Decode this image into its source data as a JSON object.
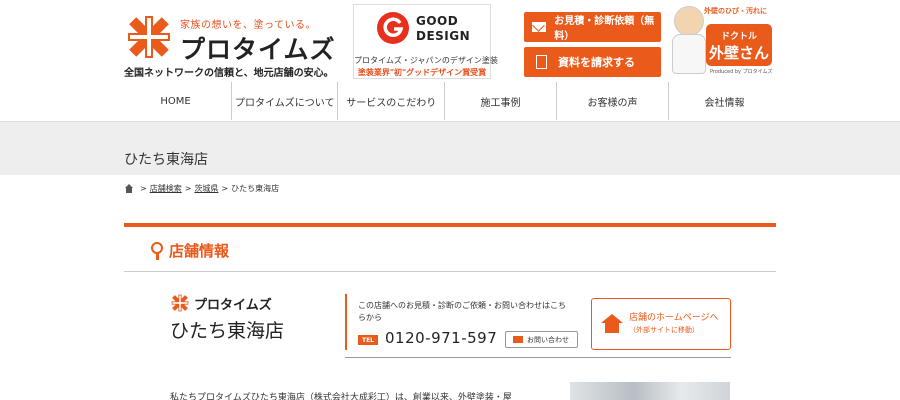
{
  "header": {
    "tagline": "家族の想いを、塗っている。",
    "brand_name": "プロタイムズ",
    "logo_sub": "全国ネットワークの信頼と、地元店舗の安心。",
    "good_design": {
      "title_line1": "GOOD",
      "title_line2": "DESIGN",
      "line1": "プロタイムズ・ジャパンのデザイン塗装",
      "line2": "塗装業界\"初\"グッドデザイン賞受賞"
    },
    "buttons": {
      "estimate": "お見積・診断依頼（無料）",
      "brochure": "資料を請求する"
    },
    "mascot": {
      "arc_text": "外壁のひび・汚れに",
      "badge_top": "ドクトル",
      "badge_main": "外壁さん",
      "produced_by": "Produced by プロタイムズ"
    }
  },
  "nav": {
    "items": [
      "HOME",
      "プロタイムズについて",
      "サービスのこだわり",
      "施工事例",
      "お客様の声",
      "会社情報"
    ]
  },
  "page_title": "ひたち東海店",
  "breadcrumb": {
    "items": [
      "店舗検索",
      "茨城県",
      "ひたち東海店"
    ],
    "separator": ">"
  },
  "section": {
    "title": "店舗情報"
  },
  "store": {
    "logo_name": "プロタイムズ",
    "name": "ひたち東海店",
    "inquiry_text": "この店舗へのお見積・診断のご依頼・お問い合わせはこちらから",
    "tel_label": "TEL",
    "tel_number": "0120-971-597",
    "inquiry_button": "お問い合わせ",
    "homepage_button_line1": "店舗のホームページへ",
    "homepage_button_line2": "（外部サイトに移動）",
    "body_text": "私たちプロタイムズひたち東海店（株式会社大成彩工）は、創業以来、外壁塗装・屋"
  },
  "colors": {
    "accent": "#ea5a1a",
    "band": "#eeeeee"
  }
}
